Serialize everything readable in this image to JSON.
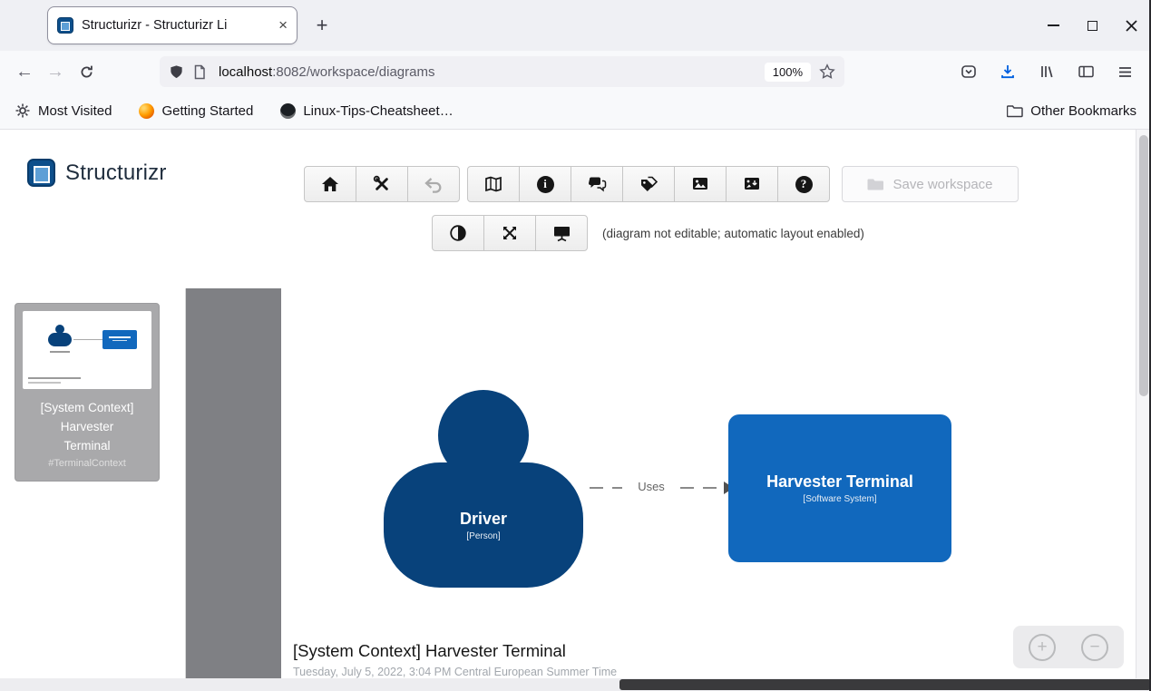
{
  "browser": {
    "tab_title": "Structurizr - Structurizr Li",
    "url_host": "localhost",
    "url_rest": ":8082/workspace/diagrams",
    "zoom_badge": "100%",
    "bookmarks": {
      "items": [
        "Most Visited",
        "Getting Started",
        "Linux-Tips-Cheatsheet…"
      ],
      "other_label": "Other Bookmarks"
    }
  },
  "app": {
    "brand": "Structurizr",
    "save_workspace_label": "Save workspace",
    "status_note": "(diagram not editable; automatic layout enabled)"
  },
  "sidebar": {
    "thumbnail": {
      "title_lines": [
        "[System Context]",
        "Harvester",
        "Terminal"
      ],
      "tag": "#TerminalContext"
    }
  },
  "diagram": {
    "person_name": "Driver",
    "person_meta": "[Person]",
    "relationship_label": "Uses",
    "system_name": "Harvester Terminal",
    "system_meta": "[Software System]",
    "title": "[System Context] Harvester Terminal",
    "timestamp": "Tuesday, July 5, 2022, 3:04 PM Central European Summer Time"
  },
  "icons": {
    "back": "←",
    "forward": "→",
    "new_tab": "+",
    "tab_close": "×",
    "info": "i",
    "help": "?",
    "zoom_in": "+",
    "zoom_out": "−"
  },
  "colors": {
    "person": "#08427b",
    "system": "#1168bd",
    "accent": "#0060df"
  }
}
